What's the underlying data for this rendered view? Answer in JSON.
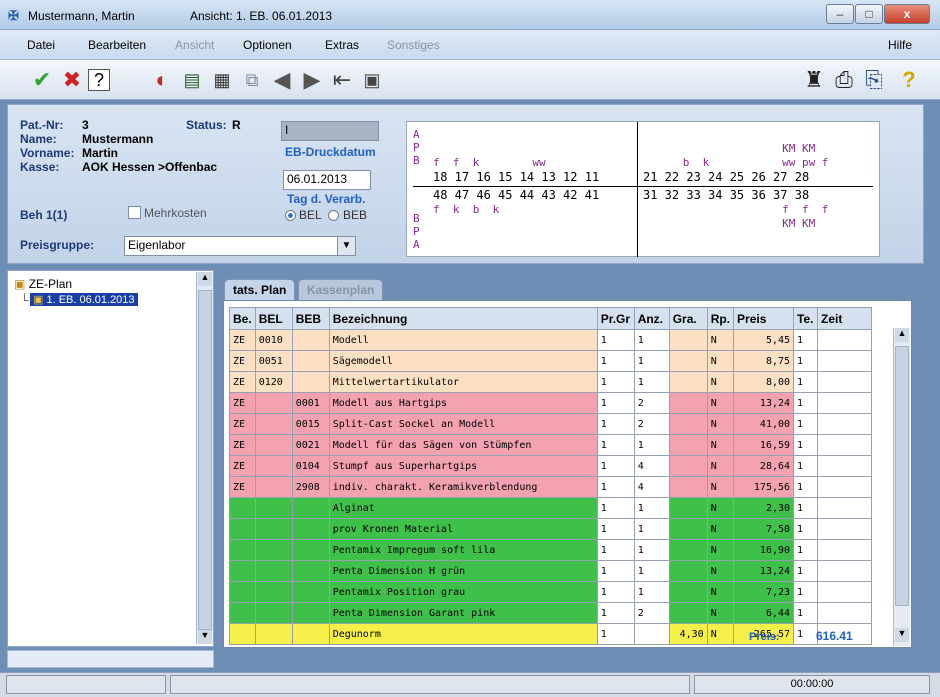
{
  "window": {
    "title": "Mustermann, Martin",
    "view_label": "Ansicht: 1. EB. 06.01.2013",
    "minimize": "–",
    "maximize": "□",
    "close": "x"
  },
  "menu": [
    "Datei",
    "Bearbeiten",
    "Ansicht",
    "Optionen",
    "Extras",
    "Sonstiges",
    "Hilfe"
  ],
  "menu_disabled": [
    false,
    false,
    true,
    false,
    false,
    true,
    false
  ],
  "toolbar": {
    "icons": [
      "check-icon",
      "cancel-x-icon",
      "help-query-icon",
      "pill-icon",
      "document-icon",
      "status-table-icon",
      "copy-icon",
      "arrow-left-icon",
      "arrow-right-icon",
      "delete-arrow-icon",
      "print-preview-icon",
      "stamp-icon",
      "printer-icon",
      "printer-group-icon",
      "help-icon"
    ]
  },
  "patient": {
    "nr_label": "Pat.-Nr:",
    "nr": "3",
    "status_label": "Status:",
    "status": "R",
    "name_label": "Name:",
    "name": "Mustermann",
    "vorname_label": "Vorname:",
    "vorname": "Martin",
    "kasse_label": "Kasse:",
    "kasse": "AOK Hessen >Offenbac",
    "beh_label": "Beh 1(1)",
    "mehrkosten_label": "Mehrkosten",
    "preisgruppe_label": "Preisgruppe:",
    "preisgruppe": "Eigenlabor",
    "druckdatum_label": "EB-Druckdatum",
    "druckdatum": "06.01.2013",
    "verarb_label": "Tag d. Verarb.",
    "radio_bel": "BEL",
    "radio_beb": "BEB",
    "input_value": "I"
  },
  "dental": {
    "side_top": "A\nP\nB",
    "side_bottom": "B\nP\nA",
    "upper_left": "18 17 16 15 14 13 12 11",
    "upper_right": "21 22 23 24 25 26 27 28",
    "lower_left": "48 47 46 45 44 43 42 41",
    "lower_right": "31 32 33 34 35 36 37 38",
    "marks_upper_left": "f  f  k        ww",
    "marks_upper_right": "      b  k           ww pw f",
    "marks_top_right": "                     KM KM",
    "marks_lower_left": "f  k  b  k",
    "marks_lower_right": "                     f  f  f",
    "marks_bottom_right": "                     KM KM"
  },
  "tree": {
    "root": "ZE-Plan",
    "child": "1. EB. 06.01.2013"
  },
  "tabs": [
    "tats. Plan",
    "Kassenplan"
  ],
  "table": {
    "headers": [
      "Be.",
      "BEL",
      "BEB",
      "Bezeichnung",
      "Pr.Gr",
      "Anz.",
      "Gra.",
      "Rp.",
      "Preis",
      "Te.",
      "Zeit"
    ],
    "rows": [
      {
        "c": "or",
        "cells": [
          "ZE",
          "0010",
          "",
          "Modell",
          "1",
          "1",
          "",
          "N",
          "5,45",
          "1",
          ""
        ]
      },
      {
        "c": "or",
        "cells": [
          "ZE",
          "0051",
          "",
          "Sägemodell",
          "1",
          "1",
          "",
          "N",
          "8,75",
          "1",
          ""
        ]
      },
      {
        "c": "or",
        "cells": [
          "ZE",
          "0120",
          "",
          "Mittelwertartikulator",
          "1",
          "1",
          "",
          "N",
          "8,00",
          "1",
          ""
        ]
      },
      {
        "c": "pk",
        "cells": [
          "ZE",
          "",
          "0001",
          "Modell aus Hartgips",
          "1",
          "2",
          "",
          "N",
          "13,24",
          "1",
          ""
        ]
      },
      {
        "c": "pk",
        "cells": [
          "ZE",
          "",
          "0015",
          "Split-Cast Sockel an Modell",
          "1",
          "2",
          "",
          "N",
          "41,00",
          "1",
          ""
        ]
      },
      {
        "c": "pk",
        "cells": [
          "ZE",
          "",
          "0021",
          "Modell für das Sägen von Stümpfen",
          "1",
          "1",
          "",
          "N",
          "16,59",
          "1",
          ""
        ]
      },
      {
        "c": "pk",
        "cells": [
          "ZE",
          "",
          "0104",
          "Stumpf aus Superhartgips",
          "1",
          "4",
          "",
          "N",
          "28,64",
          "1",
          ""
        ]
      },
      {
        "c": "pk",
        "cells": [
          "ZE",
          "",
          "2908",
          "indiv. charakt. Keramikverblendung",
          "1",
          "4",
          "",
          "N",
          "175,56",
          "1",
          ""
        ]
      },
      {
        "c": "gr",
        "cells": [
          "",
          "",
          "",
          "Alginat",
          "1",
          "1",
          "",
          "N",
          "2,30",
          "1",
          ""
        ]
      },
      {
        "c": "gr",
        "cells": [
          "",
          "",
          "",
          "prov Kronen Material",
          "1",
          "1",
          "",
          "N",
          "7,50",
          "1",
          ""
        ]
      },
      {
        "c": "gr",
        "cells": [
          "",
          "",
          "",
          "Pentamix Impregum soft lila",
          "1",
          "1",
          "",
          "N",
          "16,90",
          "1",
          ""
        ]
      },
      {
        "c": "gr",
        "cells": [
          "",
          "",
          "",
          "Penta Dimension H grün",
          "1",
          "1",
          "",
          "N",
          "13,24",
          "1",
          ""
        ]
      },
      {
        "c": "gr",
        "cells": [
          "",
          "",
          "",
          "Pentamix Position grau",
          "1",
          "1",
          "",
          "N",
          "7,23",
          "1",
          ""
        ]
      },
      {
        "c": "gr",
        "cells": [
          "",
          "",
          "",
          "Penta Dimension Garant pink",
          "1",
          "2",
          "",
          "N",
          "6,44",
          "1",
          ""
        ]
      },
      {
        "c": "yl",
        "cells": [
          "",
          "",
          "",
          "Degunorm",
          "1",
          "",
          "4,30",
          "N",
          "265,57",
          "1",
          ""
        ]
      }
    ],
    "total_label": "Preis:",
    "total_value": "616.41"
  },
  "status": {
    "time": "00:00:00"
  },
  "colors": {
    "orange_row": "#fbe0c4",
    "pink_row": "#f4a2b0",
    "green_row": "#3ec04a",
    "yellow_row": "#f5f04a",
    "accent": "#2060c8"
  }
}
